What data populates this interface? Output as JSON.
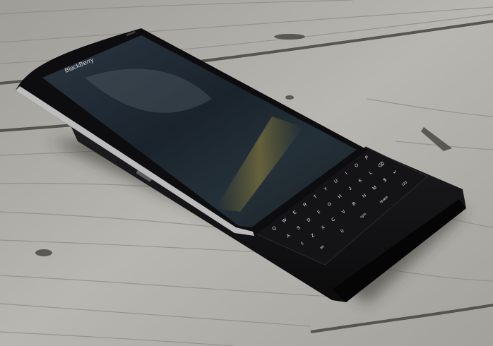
{
  "photo": {
    "brand_wordmark": "BlackBerry"
  },
  "colors": {
    "wood_light": "#b4b2ac",
    "wood_dark": "#6f6e69",
    "device_body": "#141416",
    "screen": "#1f2a33",
    "bezel_metal": "#c9c9c9",
    "key_label": "#e8e8e8"
  },
  "keyboard": {
    "rows": [
      [
        "Q",
        "W",
        "E",
        "R",
        "T",
        "Y",
        "U",
        "I",
        "O",
        "P"
      ],
      [
        "A",
        "S",
        "D",
        "F",
        "G",
        "H",
        "J",
        "K",
        "L",
        "⌫"
      ],
      [
        "⇧",
        "Z",
        "X",
        "C",
        "V",
        "B",
        "N",
        "M",
        "$",
        "↵"
      ],
      [
        "alt",
        "0",
        "sym",
        "space",
        "123"
      ]
    ]
  }
}
